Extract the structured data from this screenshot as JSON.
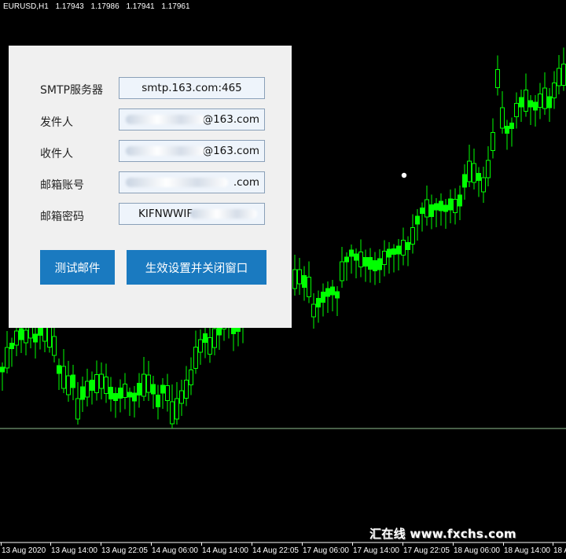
{
  "chart": {
    "symbol": "EURUSD,H1",
    "open": "1.17943",
    "high": "1.17986",
    "low": "1.17941",
    "close": "1.17961",
    "time_labels": [
      "13 Aug 2020",
      "13 Aug 14:00",
      "13 Aug 22:05",
      "14 Aug 06:00",
      "14 Aug 14:00",
      "14 Aug 22:05",
      "17 Aug 06:00",
      "17 Aug 14:00",
      "17 Aug 22:05",
      "18 Aug 06:00",
      "18 Aug 14:00",
      "18 Au"
    ],
    "watermark": "汇在线 www.fxchs.com",
    "colors": {
      "background": "#000000",
      "bull": "#00ff00",
      "bear": "#00ff00",
      "text": "#ffffff"
    }
  },
  "dialog": {
    "smtp_label": "SMTP服务器",
    "smtp_value": "smtp.163.com:465",
    "sender_label": "发件人",
    "sender_value": "@163.com",
    "recipient_label": "收件人",
    "recipient_value": "@163.com",
    "account_label": "邮箱账号",
    "account_value": ".com",
    "password_label": "邮箱密码",
    "password_value": "KIFNWWIF",
    "test_button": "测试邮件",
    "apply_button": "生效设置并关闭窗口",
    "colors": {
      "panel": "#f0f0f0",
      "button": "#1a7ac0",
      "field": "#eef4fb"
    }
  }
}
